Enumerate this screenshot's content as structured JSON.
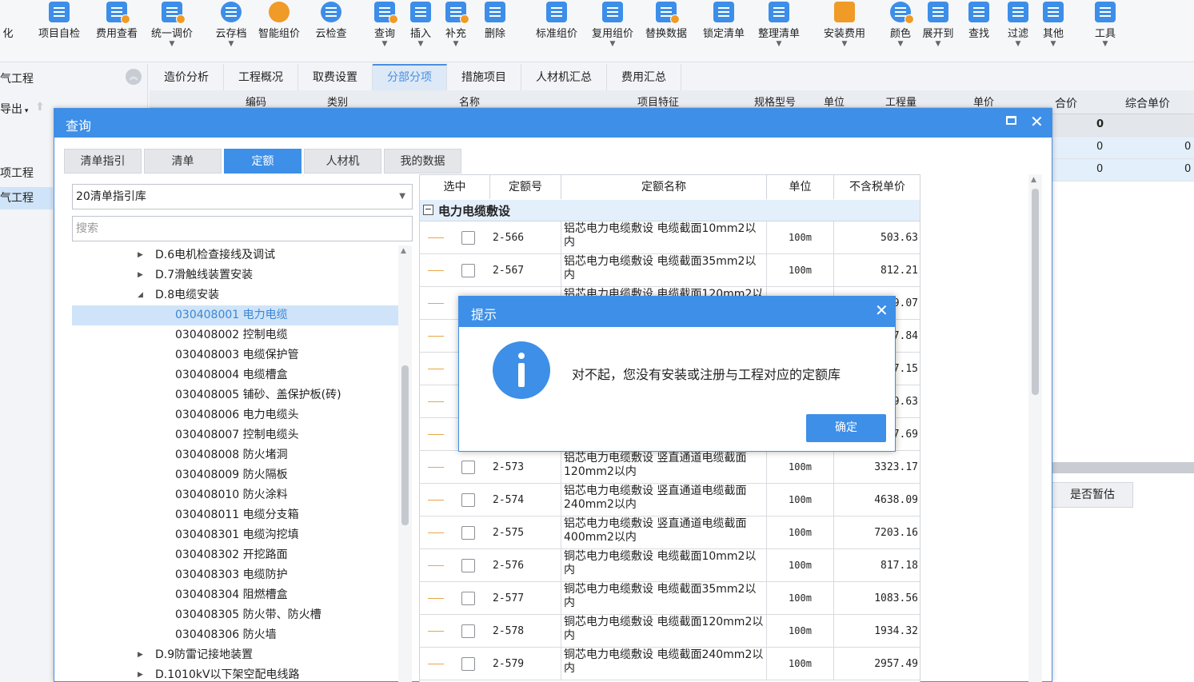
{
  "toolbar": {
    "items": [
      {
        "label": "化",
        "icon": "partial-icon"
      },
      {
        "label": "项目自检",
        "icon": "project-check-icon"
      },
      {
        "label": "费用查看",
        "icon": "fee-view-icon"
      },
      {
        "label": "统一调价",
        "icon": "unified-price-icon"
      },
      {
        "label": "云存档",
        "icon": "cloud-save-icon"
      },
      {
        "label": "智能组价",
        "icon": "smart-pricing-icon"
      },
      {
        "label": "云检查",
        "icon": "cloud-check-icon"
      },
      {
        "label": "查询",
        "icon": "query-icon"
      },
      {
        "label": "插入",
        "icon": "insert-icon"
      },
      {
        "label": "补充",
        "icon": "supplement-icon"
      },
      {
        "label": "删除",
        "icon": "delete-icon"
      },
      {
        "label": "标准组价",
        "icon": "standard-pricing-icon"
      },
      {
        "label": "复用组价",
        "icon": "reuse-pricing-icon"
      },
      {
        "label": "替换数据",
        "icon": "replace-data-icon"
      },
      {
        "label": "锁定清单",
        "icon": "lock-list-icon"
      },
      {
        "label": "整理清单",
        "icon": "organize-list-icon"
      },
      {
        "label": "安装费用",
        "icon": "install-fee-icon"
      },
      {
        "label": "颜色",
        "icon": "color-icon"
      },
      {
        "label": "展开到",
        "icon": "expand-to-icon"
      },
      {
        "label": "查找",
        "icon": "find-icon"
      },
      {
        "label": "过滤",
        "icon": "filter-icon"
      },
      {
        "label": "其他",
        "icon": "other-icon"
      },
      {
        "label": "工具",
        "icon": "tools-icon"
      }
    ]
  },
  "sidebar": {
    "project": "气工程",
    "export": "导出",
    "items": [
      "项工程",
      "气工程"
    ]
  },
  "main_tabs": [
    "造价分析",
    "工程概况",
    "取费设置",
    "分部分项",
    "措施项目",
    "人材机汇总",
    "费用汇总"
  ],
  "main_tab_active": "分部分项",
  "background_grid": {
    "headers": [
      "编码",
      "类别",
      "名称",
      "项目特征",
      "规格型号",
      "单位",
      "工程量",
      "单价",
      "合价",
      "综合单价"
    ],
    "rows": [
      [
        "0"
      ],
      [
        "0",
        "0"
      ],
      [
        "0",
        "0"
      ]
    ],
    "estimate_label": "是否暂估"
  },
  "query_window": {
    "title": "查询",
    "tabs": [
      "清单指引",
      "清单",
      "定额",
      "人材机",
      "我的数据"
    ],
    "active_tab": "定额",
    "library": "20清单指引库",
    "search_placeholder": "搜索",
    "tree": [
      {
        "text": "D.6电机检查接线及调试",
        "level": 1,
        "toggle": "▶"
      },
      {
        "text": "D.7滑触线装置安装",
        "level": 1,
        "toggle": "▶"
      },
      {
        "text": "D.8电缆安装",
        "level": 1,
        "toggle": "◢"
      },
      {
        "text": "030408001  电力电缆",
        "level": 2,
        "selected": true
      },
      {
        "text": "030408002  控制电缆",
        "level": 2
      },
      {
        "text": "030408003  电缆保护管",
        "level": 2
      },
      {
        "text": "030408004  电缆槽盒",
        "level": 2
      },
      {
        "text": "030408005  铺砂、盖保护板(砖)",
        "level": 2
      },
      {
        "text": "030408006  电力电缆头",
        "level": 2
      },
      {
        "text": "030408007  控制电缆头",
        "level": 2
      },
      {
        "text": "030408008  防火堵洞",
        "level": 2
      },
      {
        "text": "030408009  防火隔板",
        "level": 2
      },
      {
        "text": "030408010  防火涂料",
        "level": 2
      },
      {
        "text": "030408011  电缆分支箱",
        "level": 2
      },
      {
        "text": "030408301  电缆沟挖填",
        "level": 2
      },
      {
        "text": "030408302  开挖路面",
        "level": 2
      },
      {
        "text": "030408303  电缆防护",
        "level": 2
      },
      {
        "text": "030408304  阻燃槽盒",
        "level": 2
      },
      {
        "text": "030408305  防火带、防火槽",
        "level": 2
      },
      {
        "text": "030408306  防火墙",
        "level": 2
      },
      {
        "text": "D.9防雷记接地装置",
        "level": 1,
        "toggle": "▶"
      },
      {
        "text": "D.1010kV以下架空配电线路",
        "level": 1,
        "toggle": "▶"
      }
    ],
    "grid": {
      "headers": [
        "选中",
        "定额号",
        "定额名称",
        "单位",
        "不含税单价"
      ],
      "group": "电力电缆敷设",
      "rows": [
        {
          "code": "2-566",
          "name": "铝芯电力电缆敷设 电缆截面10mm2以内",
          "unit": "100m",
          "price": "503.63"
        },
        {
          "code": "2-567",
          "name": "铝芯电力电缆敷设 电缆截面35mm2以内",
          "unit": "100m",
          "price": "812.21"
        },
        {
          "code": "",
          "name": "铝芯电力电缆敷设 电缆截面120mm2以内",
          "unit": "",
          "price": "9.07"
        },
        {
          "code": "",
          "name": "",
          "unit": "",
          "price": "7.84"
        },
        {
          "code": "",
          "name": "",
          "unit": "",
          "price": "7.15"
        },
        {
          "code": "",
          "name": "",
          "unit": "",
          "price": "9.63"
        },
        {
          "code": "",
          "name": "",
          "unit": "",
          "price": "7.69"
        },
        {
          "code": "2-573",
          "name": "铝芯电力电缆敷设 竖直通道电缆截面120mm2以内",
          "unit": "100m",
          "price": "3323.17"
        },
        {
          "code": "2-574",
          "name": "铝芯电力电缆敷设 竖直通道电缆截面240mm2以内",
          "unit": "100m",
          "price": "4638.09"
        },
        {
          "code": "2-575",
          "name": "铝芯电力电缆敷设 竖直通道电缆截面400mm2以内",
          "unit": "100m",
          "price": "7203.16"
        },
        {
          "code": "2-576",
          "name": "铜芯电力电缆敷设 电缆截面10mm2以内",
          "unit": "100m",
          "price": "817.18"
        },
        {
          "code": "2-577",
          "name": "铜芯电力电缆敷设 电缆截面35mm2以内",
          "unit": "100m",
          "price": "1083.56"
        },
        {
          "code": "2-578",
          "name": "铜芯电力电缆敷设 电缆截面120mm2以内",
          "unit": "100m",
          "price": "1934.32"
        },
        {
          "code": "2-579",
          "name": "铜芯电力电缆敷设 电缆截面240mm2以内",
          "unit": "100m",
          "price": "2957.49"
        }
      ]
    }
  },
  "dialog": {
    "title": "提示",
    "message": "对不起，您没有安装或注册与工程对应的定额库",
    "ok": "确定",
    "icon": "info-icon"
  },
  "colors": {
    "accent": "#3d8fe8",
    "selected_row": "#cfe4f8",
    "group_row": "#e3effa",
    "orange": "#f09a28"
  }
}
